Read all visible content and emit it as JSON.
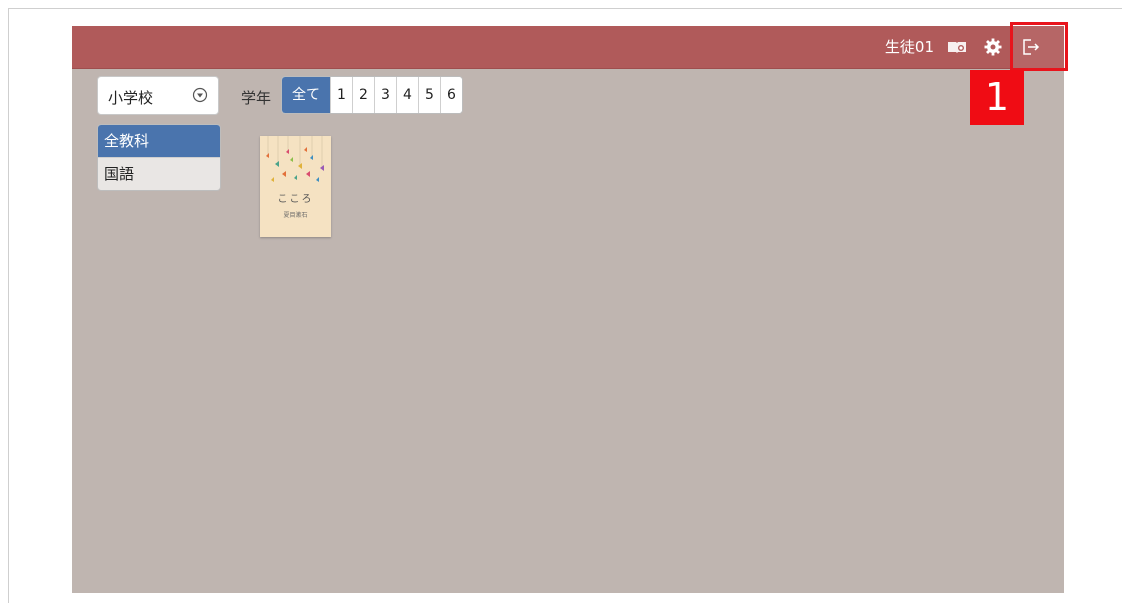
{
  "header": {
    "user_name": "生徒01",
    "icons": [
      "book-icon",
      "gear-icon",
      "logout-icon"
    ],
    "colors": {
      "bar": "#b05a5a",
      "background": "#bfb5b0"
    }
  },
  "callout": {
    "number": "1"
  },
  "filters": {
    "school_select": {
      "value": "小学校"
    },
    "grade_label": "学年",
    "grades": [
      "全て",
      "1",
      "2",
      "3",
      "4",
      "5",
      "6"
    ],
    "active_grade": "全て",
    "accent_color": "#4a74ad"
  },
  "subjects": {
    "items": [
      {
        "label": "全教科",
        "active": true
      },
      {
        "label": "国語",
        "active": false
      }
    ]
  },
  "books": [
    {
      "title": "こころ",
      "author": "夏目漱石"
    }
  ]
}
